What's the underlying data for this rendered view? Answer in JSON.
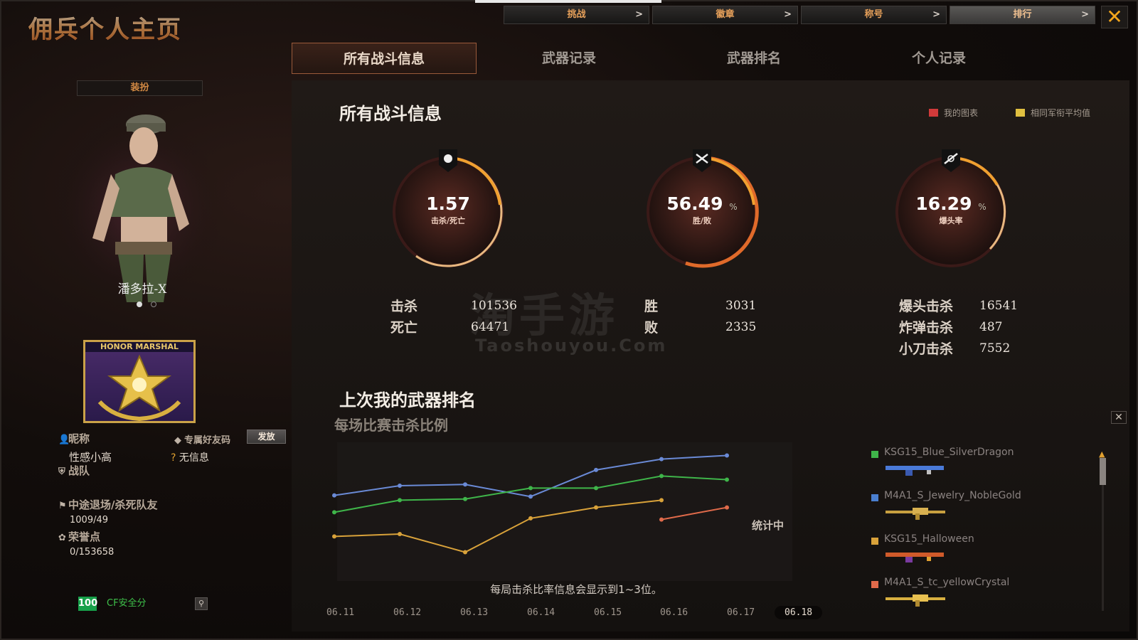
{
  "header": {
    "title": "佣兵个人主页"
  },
  "topnav": [
    {
      "label": "挑战",
      "active": false
    },
    {
      "label": "徽章",
      "active": false
    },
    {
      "label": "称号",
      "active": false
    },
    {
      "label": "排行",
      "active": true
    }
  ],
  "tabs": [
    {
      "label": "所有战斗信息",
      "active": true
    },
    {
      "label": "武器记录",
      "active": false
    },
    {
      "label": "武器排名",
      "active": false
    },
    {
      "label": "个人记录",
      "active": false
    }
  ],
  "left": {
    "dress_button": "装扮",
    "character_name": "潘多拉-X",
    "badge_title": "HONOR MARSHAL",
    "nickname_label": "昵称",
    "nickname_value": "性感小高",
    "friend_code_label": "专属好友码",
    "send_button": "发放",
    "friend_code_value": "无信息",
    "team_label": "战队",
    "quit_label": "中途退场/杀死队友",
    "quit_value": "1009/49",
    "honor_label": "荣誉点",
    "honor_value": "0/153658",
    "security_score": "100",
    "security_label": "CF安全分"
  },
  "main": {
    "title": "所有战斗信息",
    "legend_mine": "我的图表",
    "legend_avg": "相同军衔平均值",
    "gauges": [
      {
        "value": "1.57",
        "unit": "",
        "label": "击杀/死亡",
        "icon": "skull-icon"
      },
      {
        "value": "56.49",
        "unit": "%",
        "label": "胜/败",
        "icon": "crossed-swords-icon"
      },
      {
        "value": "16.29",
        "unit": "%",
        "label": "爆头率",
        "icon": "headshot-icon"
      }
    ],
    "stats": {
      "kills_label": "击杀",
      "kills": "101536",
      "deaths_label": "死亡",
      "deaths": "64471",
      "wins_label": "胜",
      "wins": "3031",
      "losses_label": "败",
      "losses": "2335",
      "headshot_label": "爆头击杀",
      "headshot": "16541",
      "bomb_label": "炸弹击杀",
      "bomb": "487",
      "knife_label": "小刀击杀",
      "knife": "7552"
    },
    "watermark": "淘手游",
    "watermark_sub": "Taoshouyou.Com",
    "sub_title": "上次我的武器排名",
    "sub_sub": "每场比赛击杀比例",
    "chart_note": "每局击杀比率信息会显示到1~3位。",
    "chart_status": "统计中",
    "x_labels": [
      "06.11",
      "06.12",
      "06.13",
      "06.14",
      "06.15",
      "06.16",
      "06.17",
      "06.18"
    ],
    "weapons": [
      {
        "name": "KSG15_Blue_SilverDragon",
        "color": "#3fb54a"
      },
      {
        "name": "M4A1_S_Jewelry_NobleGold",
        "color": "#4a7fd0"
      },
      {
        "name": "KSG15_Halloween",
        "color": "#d9a23a"
      },
      {
        "name": "M4A1_S_tc_yellowCrystal",
        "color": "#e06a4a"
      }
    ]
  },
  "chart_data": {
    "type": "line",
    "categories": [
      "06.11",
      "06.12",
      "06.13",
      "06.14",
      "06.15",
      "06.16",
      "06.17"
    ],
    "series": [
      {
        "color": "#6a8ad6",
        "values": [
          0.62,
          0.7,
          0.71,
          0.61,
          0.83,
          0.92,
          0.95
        ]
      },
      {
        "color": "#3fb54a",
        "values": [
          0.48,
          0.58,
          0.59,
          0.68,
          0.68,
          0.78,
          0.75
        ]
      },
      {
        "color": "#d9a23a",
        "values": [
          0.28,
          0.3,
          0.15,
          0.43,
          0.52,
          0.58,
          null
        ]
      },
      {
        "color": "#e06a4a",
        "values": [
          null,
          null,
          null,
          null,
          null,
          0.42,
          0.52
        ]
      }
    ]
  }
}
